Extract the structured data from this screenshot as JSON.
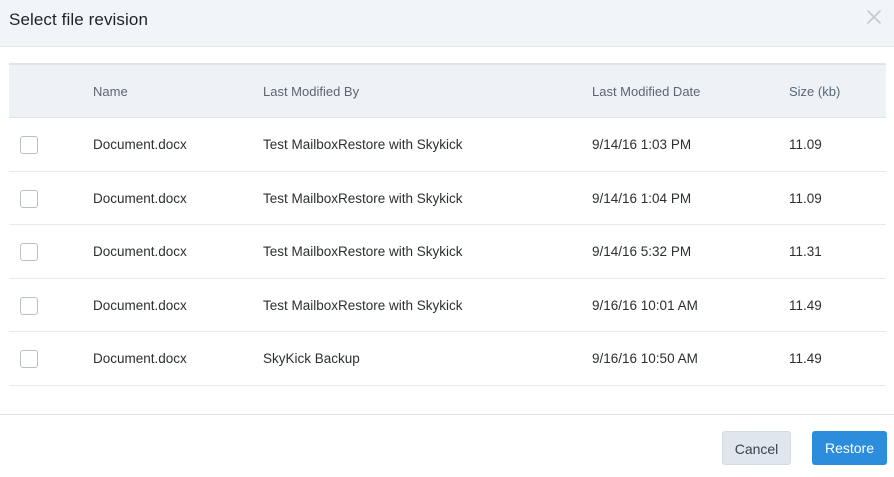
{
  "dialog": {
    "title": "Select file revision",
    "close_icon": "close-icon"
  },
  "table": {
    "columns": [
      "Name",
      "Last Modified By",
      "Last Modified Date",
      "Size (kb)"
    ],
    "rows": [
      {
        "checked": false,
        "name": "Document.docx",
        "modified_by": "Test MailboxRestore with Skykick",
        "modified_date": "9/14/16 1:03 PM",
        "size": "11.09"
      },
      {
        "checked": false,
        "name": "Document.docx",
        "modified_by": "Test MailboxRestore with Skykick",
        "modified_date": "9/14/16 1:04 PM",
        "size": "11.09"
      },
      {
        "checked": false,
        "name": "Document.docx",
        "modified_by": "Test MailboxRestore with Skykick",
        "modified_date": "9/14/16 5:32 PM",
        "size": "11.31"
      },
      {
        "checked": false,
        "name": "Document.docx",
        "modified_by": "Test MailboxRestore with Skykick",
        "modified_date": "9/16/16 10:01 AM",
        "size": "11.49"
      },
      {
        "checked": false,
        "name": "Document.docx",
        "modified_by": "SkyKick Backup",
        "modified_date": "9/16/16 10:50 AM",
        "size": "11.49"
      }
    ]
  },
  "footer": {
    "cancel_label": "Cancel",
    "restore_label": "Restore"
  },
  "colors": {
    "header_bg": "#f1f4f8",
    "table_header_bg": "#eef2f7",
    "primary": "#2b8ddc",
    "secondary_button": "#dfe6ee"
  }
}
